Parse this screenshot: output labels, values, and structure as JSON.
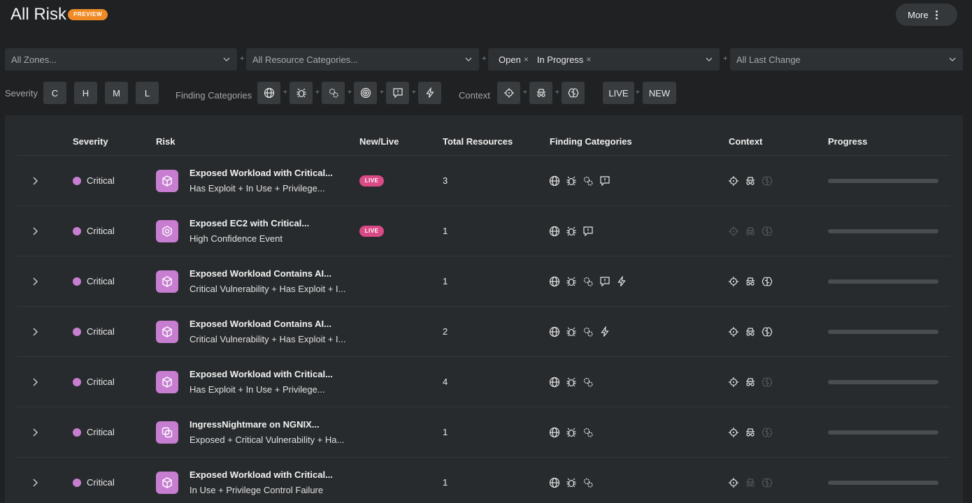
{
  "header": {
    "title": "All Risk",
    "badge": "PREVIEW",
    "more_label": "More"
  },
  "filters": {
    "zones_placeholder": "All Zones...",
    "resource_categories_placeholder": "All Resource Categories...",
    "status_chips": [
      "Open",
      "In Progress"
    ],
    "last_change_placeholder": "All Last Change",
    "plus": "+"
  },
  "severity_filter": {
    "label": "Severity",
    "options": [
      "C",
      "H",
      "M",
      "L"
    ]
  },
  "finding_categories_filter": {
    "label": "Finding Categories",
    "icons": [
      "globe-icon",
      "bug-icon",
      "gears-icon",
      "fingerprint-icon",
      "chat-alert-icon",
      "lightning-icon"
    ]
  },
  "context_filter": {
    "label": "Context",
    "icons": [
      "crosshair-icon",
      "incognito-icon",
      "brain-icon"
    ],
    "live_label": "LIVE",
    "new_label": "NEW"
  },
  "table": {
    "columns": [
      "Severity",
      "Risk",
      "New/Live",
      "Total Resources",
      "Finding Categories",
      "Context",
      "Progress"
    ],
    "live_badge": "LIVE",
    "rows": [
      {
        "severity": "Critical",
        "icon": "cube-icon",
        "title": "Exposed Workload with Critical...",
        "subtitle": "Has Exploit + In Use + Privilege...",
        "live": true,
        "total": "3",
        "findings": [
          "globe",
          "bug",
          "gears",
          "chat"
        ],
        "context": [
          1,
          1,
          0
        ],
        "progress": 0
      },
      {
        "severity": "Critical",
        "icon": "ec2-icon",
        "title": "Exposed EC2 with Critical...",
        "subtitle": "High Confidence Event",
        "live": true,
        "total": "1",
        "findings": [
          "globe",
          "bug",
          "chat"
        ],
        "context": [
          0,
          0,
          0
        ],
        "progress": 0
      },
      {
        "severity": "Critical",
        "icon": "cube-icon",
        "title": "Exposed Workload Contains AI...",
        "subtitle": "Critical Vulnerability + Has Exploit + I...",
        "live": false,
        "total": "1",
        "findings": [
          "globe",
          "bug",
          "gears",
          "chat",
          "lightning"
        ],
        "context": [
          1,
          1,
          1
        ],
        "progress": 0
      },
      {
        "severity": "Critical",
        "icon": "cube-icon",
        "title": "Exposed Workload Contains AI...",
        "subtitle": "Critical Vulnerability + Has Exploit + I...",
        "live": false,
        "total": "2",
        "findings": [
          "globe",
          "bug",
          "gears",
          "lightning"
        ],
        "context": [
          1,
          1,
          1
        ],
        "progress": 0
      },
      {
        "severity": "Critical",
        "icon": "cube-icon",
        "title": "Exposed Workload with Critical...",
        "subtitle": "Has Exploit + In Use + Privilege...",
        "live": false,
        "total": "4",
        "findings": [
          "globe",
          "bug",
          "gears"
        ],
        "context": [
          1,
          1,
          0
        ],
        "progress": 0
      },
      {
        "severity": "Critical",
        "icon": "copy-icon",
        "title": "IngressNightmare on NGNIX...",
        "subtitle": "Exposed + Critical Vulnerability + Ha...",
        "live": false,
        "total": "1",
        "findings": [
          "globe",
          "bug",
          "gears"
        ],
        "context": [
          1,
          1,
          0
        ],
        "progress": 0
      },
      {
        "severity": "Critical",
        "icon": "cube-icon",
        "title": "Exposed Workload with Critical...",
        "subtitle": "In Use + Privilege Control Failure",
        "live": false,
        "total": "1",
        "findings": [
          "globe",
          "bug",
          "gears"
        ],
        "context": [
          1,
          0,
          0
        ],
        "progress": 0
      }
    ]
  },
  "colors": {
    "background": "#1f2123",
    "panel": "#282b2d",
    "critical": "#c77ed1",
    "live": "#d94a86",
    "preview": "#f08a24"
  }
}
